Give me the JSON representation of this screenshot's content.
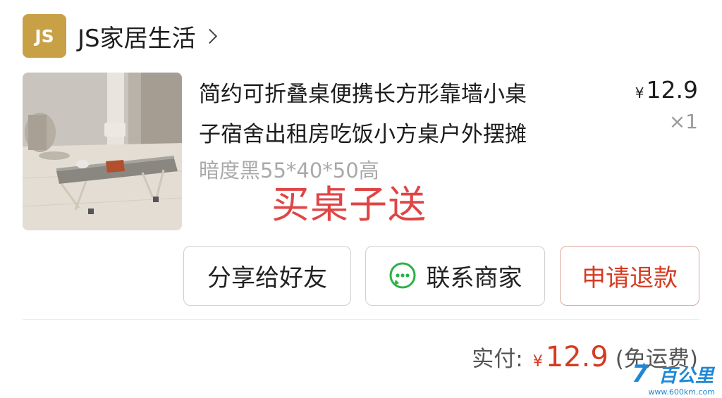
{
  "shop": {
    "logo_text": "JS",
    "name": "JS家居生活",
    "brand_color": "#c8a046"
  },
  "product": {
    "title_line1": "简约可折叠桌便携长方形靠墙小桌",
    "title_line2": "子宿舍出租房吃饭小方桌户外摆摊",
    "price_symbol": "¥",
    "price": "12.9",
    "quantity": "×1",
    "spec": "暗度黑55*40*50高",
    "promo_overlay": "买桌子送"
  },
  "actions": {
    "share_label": "分享给好友",
    "contact_label": "联系商家",
    "refund_label": "申请退款"
  },
  "payment": {
    "label": "实付:",
    "currency": "¥",
    "amount": "12.9",
    "note": "(免运费)"
  },
  "watermark": {
    "seven": "7",
    "brand": "百公里",
    "url": "www.600km.com"
  },
  "colors": {
    "accent_red": "#d63b22",
    "promo_red": "#e04545",
    "wechat_green": "#2bb14a"
  }
}
